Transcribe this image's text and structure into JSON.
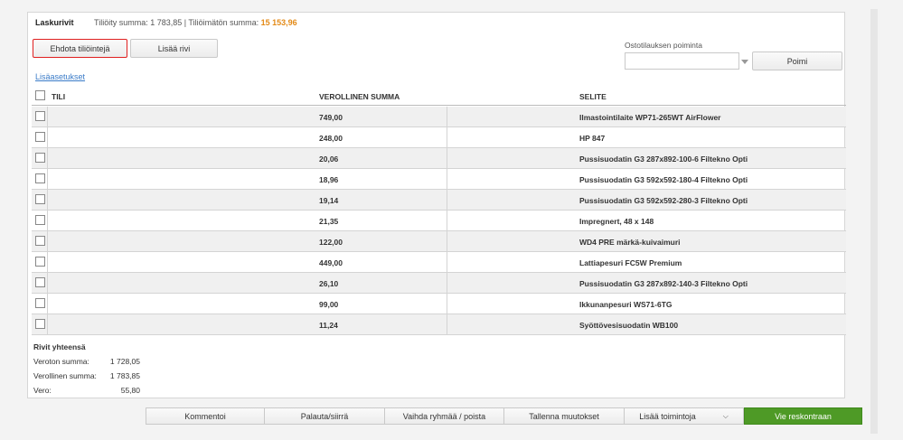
{
  "header": {
    "title": "Laskurivit",
    "sums": "Tiliöity summa: 1 783,85 | Tiliöimätön summa: ",
    "unposted_value": "15 153,96"
  },
  "toolbar": {
    "suggest_label": "Ehdota tiliöintejä",
    "add_row_label": "Lisää rivi"
  },
  "purchase_order": {
    "label": "Ostotilauksen poiminta",
    "value": "",
    "pick_label": "Poimi"
  },
  "advanced_link": "Lisäasetukset",
  "columns": {
    "account": "TILI",
    "amount": "VEROLLINEN SUMMA",
    "description": "SELITE"
  },
  "rows": [
    {
      "amount": "749,00",
      "description": "Ilmastointilaite WP71-265WT AirFlower"
    },
    {
      "amount": "248,00",
      "description": "HP 847"
    },
    {
      "amount": "20,06",
      "description": "Pussisuodatin G3 287x892-100-6 Filtekno Opti"
    },
    {
      "amount": "18,96",
      "description": "Pussisuodatin G3 592x592-180-4 Filtekno Opti"
    },
    {
      "amount": "19,14",
      "description": "Pussisuodatin G3 592x592-280-3 Filtekno Opti"
    },
    {
      "amount": "21,35",
      "description": "Impregnert, 48 x 148"
    },
    {
      "amount": "122,00",
      "description": "WD4 PRE märkä-kuivaimuri"
    },
    {
      "amount": "449,00",
      "description": "Lattiapesuri FC5W Premium"
    },
    {
      "amount": "26,10",
      "description": "Pussisuodatin G3 287x892-140-3 Filtekno Opti"
    },
    {
      "amount": "99,00",
      "description": "Ikkunanpesuri WS71-6TG"
    },
    {
      "amount": "11,24",
      "description": "Syöttövesisuodatin WB100"
    }
  ],
  "totals": {
    "title": "Rivit yhteensä",
    "net_label": "Veroton summa:",
    "net_value": "1 728,05",
    "gross_label": "Verollinen summa:",
    "gross_value": "1 783,85",
    "vat_label": "Vero:",
    "vat_value": "55,80"
  },
  "actions": {
    "comment": "Kommentoi",
    "return": "Palauta/siirrä",
    "change_group": "Vaihda ryhmää / poista",
    "save": "Tallenna muutokset",
    "more": "Lisää toimintoja",
    "submit": "Vie reskontraan"
  },
  "colors": {
    "accent_orange": "#e38a17",
    "primary_green": "#4e9a26",
    "highlight_red": "#e02020",
    "link_blue": "#3a7bc8"
  }
}
